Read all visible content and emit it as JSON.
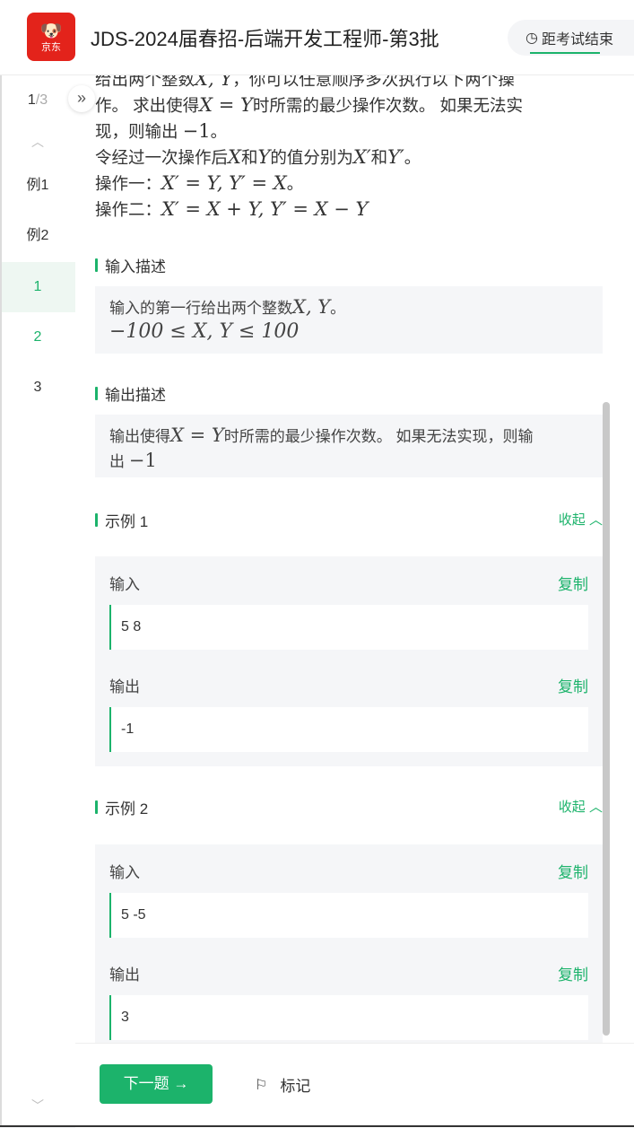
{
  "header": {
    "logo_text": "京东",
    "title": "JDS-2024届春招-后端开发工程师-第3批",
    "timer_label": "距考试结束"
  },
  "sidebar": {
    "progress_current": "1",
    "progress_total": "/3",
    "items": [
      {
        "label": "例1"
      },
      {
        "label": "例2"
      },
      {
        "label": "1"
      },
      {
        "label": "2"
      },
      {
        "label": "3"
      }
    ]
  },
  "problem": {
    "desc_line1_a": "给出两个整数",
    "desc_line1_xy": "X, Y",
    "desc_line1_b": "，你可以任意顺序多次执行以下两个操",
    "desc_line2_a": "作。 求出使得",
    "desc_line2_eq": "X = Y",
    "desc_line2_b": "时所需的最少操作次数。 如果无法实",
    "desc_line3_a": "现，则输出 ",
    "desc_line3_neg": "−1",
    "desc_line3_b": "。",
    "desc_line4_a": "令经过一次操作后",
    "desc_line4_x": "X",
    "desc_line4_b": "和",
    "desc_line4_y": "Y",
    "desc_line4_c": "的值分别为",
    "desc_line4_xp": "X′",
    "desc_line4_d": "和",
    "desc_line4_yp": "Y′",
    "desc_line4_e": "。",
    "op1_label": "操作一：",
    "op1_formula": "X′ = Y, Y′ = X",
    "op1_end": "。",
    "op2_label": "操作二：",
    "op2_formula": "X′ = X + Y, Y′ = X − Y"
  },
  "input_desc": {
    "title": "输入描述",
    "line1_a": "输入的第一行给出两个整数",
    "line1_xy": "X, Y",
    "line1_b": "。",
    "line2": "−100 ≤ X, Y ≤ 100"
  },
  "output_desc": {
    "title": "输出描述",
    "line1_a": "输出使得",
    "line1_eq": "X = Y",
    "line1_b": "时所需的最少操作次数。 如果无法实现，则输",
    "line2_a": "出 ",
    "line2_neg": "−1"
  },
  "examples": [
    {
      "title": "示例 1",
      "collapse": "收起",
      "input_label": "输入",
      "input_value": "5 8",
      "output_label": "输出",
      "output_value": "-1",
      "copy": "复制"
    },
    {
      "title": "示例 2",
      "collapse": "收起",
      "input_label": "输入",
      "input_value": "5 -5",
      "output_label": "输出",
      "output_value": "3",
      "copy": "复制"
    }
  ],
  "footer": {
    "next_label": "下一题 →",
    "mark_label": "标记"
  },
  "colors": {
    "accent": "#1cb36b",
    "logo_red": "#e3231b"
  }
}
